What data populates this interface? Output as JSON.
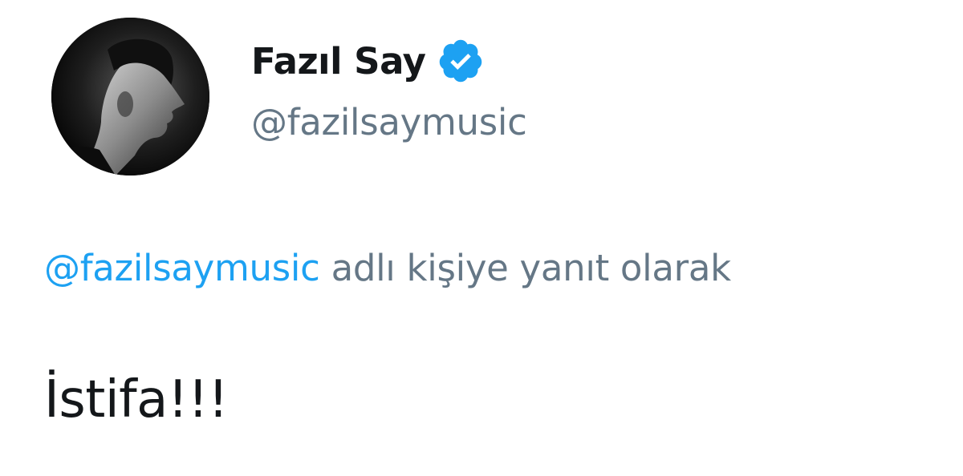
{
  "author": {
    "display_name": "Fazıl Say",
    "handle": "@fazilsaymusic",
    "verified": true,
    "verified_icon": "verified-badge-icon",
    "avatar": "profile-photo"
  },
  "reply": {
    "handle": "@fazilsaymusic",
    "suffix": "adlı kişiye yanıt olarak"
  },
  "tweet": {
    "text": "İstifa!!!"
  },
  "colors": {
    "link": "#1da1f2",
    "secondary_text": "#657786",
    "primary_text": "#14171a",
    "verified": "#1da1f2"
  }
}
